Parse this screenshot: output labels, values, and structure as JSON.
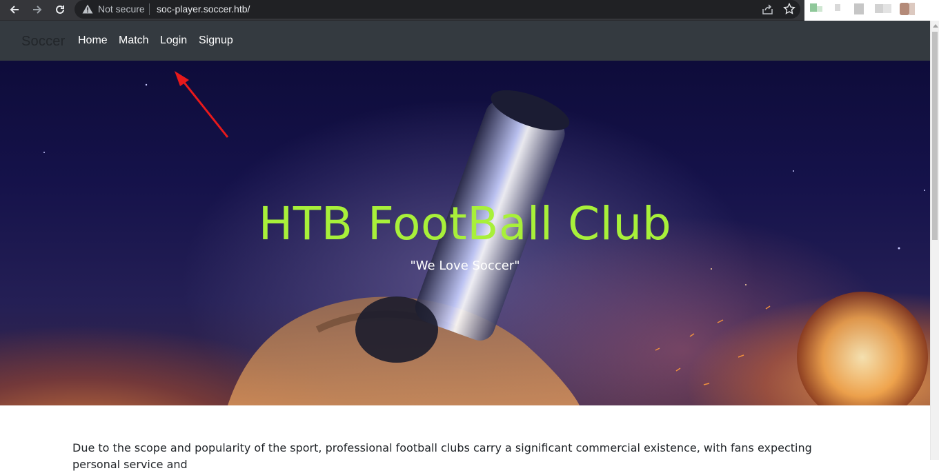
{
  "browser": {
    "security_label": "Not secure",
    "url": "soc-player.soccer.htb/"
  },
  "navbar": {
    "brand": "Soccer",
    "links": [
      "Home",
      "Match",
      "Login",
      "Signup"
    ]
  },
  "hero": {
    "title": "HTB FootBall Club",
    "subtitle": "\"We Love Soccer\""
  },
  "content": {
    "paragraph": "Due to the scope and popularity of the sport, professional football clubs carry a significant commercial existence, with fans expecting personal service and"
  },
  "colors": {
    "navbar_bg": "#343a40",
    "hero_title": "#a8f03a",
    "annotation_arrow": "#e8191b"
  }
}
